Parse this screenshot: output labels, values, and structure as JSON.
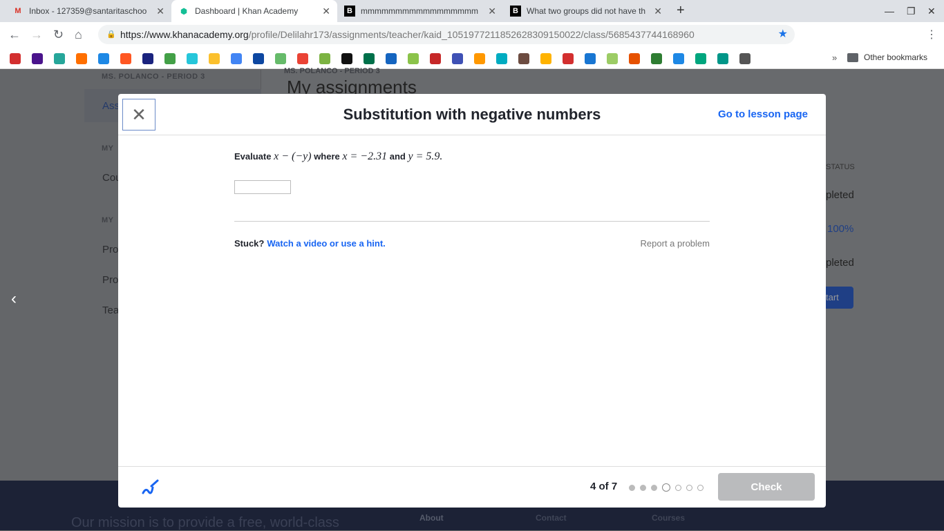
{
  "browser": {
    "tabs": [
      {
        "title": "Inbox - 127359@santaritaschoo",
        "icon": "gmail-icon",
        "color": "#d93025"
      },
      {
        "title": "Dashboard | Khan Academy",
        "icon": "khan-academy-icon",
        "color": "#14bf96",
        "active": true
      },
      {
        "title": "mmmmmmmmmmmmmmmmm",
        "icon": "brainly-icon",
        "color": "#000"
      },
      {
        "title": "What two groups did not have th",
        "icon": "brainly-icon",
        "color": "#000"
      }
    ],
    "url_domain": "https://www.khanacademy.org",
    "url_path": "/profile/Delilahr173/assignments/teacher/kaid_1051977211852628309150022/class/5685437744168960",
    "other_bookmarks": "Other bookmarks",
    "bookmark_colors": [
      "#d32f2f",
      "#4a148c",
      "#26a69a",
      "#ff6f00",
      "#1e88e5",
      "#ff5722",
      "#1a237e",
      "#43a047",
      "#26c6da",
      "#fbc02d",
      "#4285f4",
      "#0d47a1",
      "#66bb6a",
      "#ea4335",
      "#7cb342",
      "#111",
      "#00704a",
      "#1565c0",
      "#8bc34a",
      "#c62828",
      "#3f51b5",
      "#ff9800",
      "#00acc1",
      "#6d4c41",
      "#ffb300",
      "#d32f2f",
      "#1976d2",
      "#9ccc65",
      "#e65100",
      "#2e7d32",
      "#1e88e5",
      "#00a67e",
      "#009688",
      "#555"
    ]
  },
  "background": {
    "class_label": "MS. POLANCO - PERIOD 3",
    "page_title": "My assignments",
    "sidebar": [
      {
        "label": "Ass"
      },
      {
        "label": "MY"
      },
      {
        "label": "Cou"
      },
      {
        "label": "MY"
      },
      {
        "label": "Pro"
      },
      {
        "label": "Pro"
      },
      {
        "label": "Tea"
      }
    ],
    "status_header": "STATUS",
    "statuses": [
      "pleted",
      "100%",
      "pleted"
    ],
    "start_button": "tart",
    "footer": {
      "mission": "Our mission is to provide a free, world-class",
      "links": [
        "About",
        "Contact",
        "Courses"
      ]
    }
  },
  "modal": {
    "title": "Substitution with negative numbers",
    "lesson_link": "Go to lesson page",
    "question": {
      "pre": "Evaluate",
      "expr": "x − (−y)",
      "mid": "where",
      "x_eq": "x = −2.31",
      "and": "and",
      "y_eq": "y = 5.9."
    },
    "answer_value": "",
    "stuck": "Stuck?",
    "hint_link": "Watch a video or use a hint.",
    "report": "Report a problem",
    "progress": {
      "text": "4 of 7",
      "current": 4,
      "total": 7
    },
    "check": "Check"
  }
}
